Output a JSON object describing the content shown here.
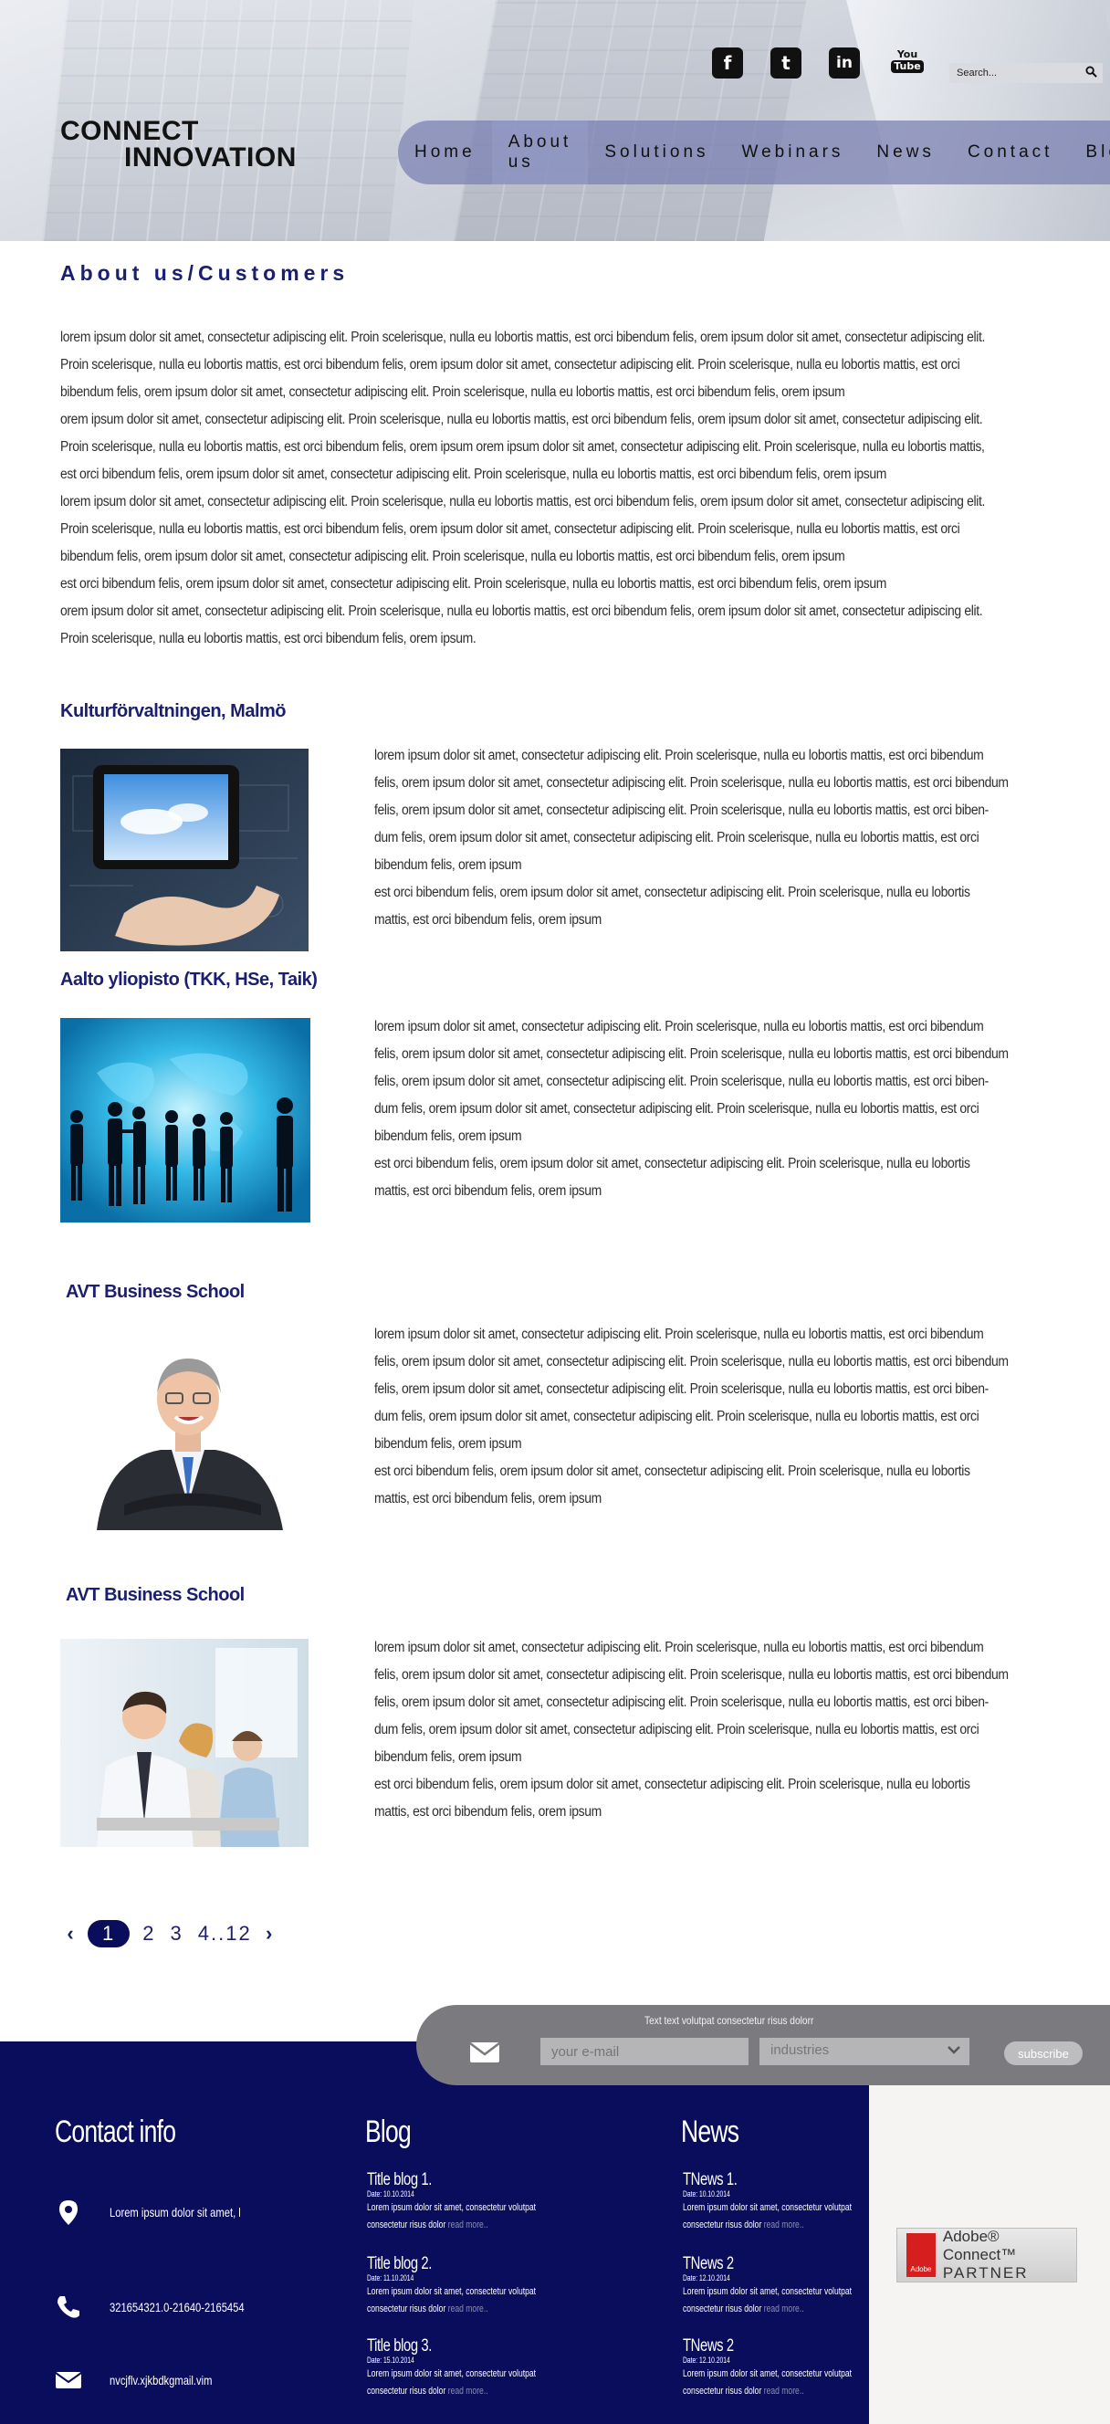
{
  "header": {
    "logo_line1": "CONNECT",
    "logo_line2": "INNOVATION",
    "social": {
      "facebook": "f",
      "twitter": "t",
      "linkedin": "in",
      "youtube_top": "You",
      "youtube_bottom": "Tube"
    },
    "search_placeholder": "Search...",
    "nav": [
      "Home",
      "About us",
      "Solutions",
      "Webinars",
      "News",
      "Contact",
      "Blog"
    ]
  },
  "main": {
    "page_title": "About us/Customers",
    "intro_lines": [
      "lorem ipsum dolor sit amet, consectetur adipiscing elit. Proin scelerisque, nulla eu lobortis mattis, est orci bibendum felis, orem ipsum dolor sit amet, consectetur adipiscing elit.",
      "Proin scelerisque, nulla eu lobortis mattis, est orci bibendum felis,  orem ipsum dolor sit amet, consectetur adipiscing elit. Proin scelerisque, nulla eu lobortis mattis, est orci",
      "bibendum felis, orem ipsum dolor sit amet, consectetur adipiscing elit. Proin scelerisque, nulla eu lobortis mattis, est orci bibendum felis, orem ipsum",
      "orem ipsum dolor sit amet, consectetur adipiscing elit. Proin scelerisque, nulla eu lobortis mattis, est orci bibendum felis, orem ipsum dolor sit amet, consectetur adipiscing elit.",
      "Proin scelerisque, nulla eu lobortis mattis, est orci bibendum felis, orem ipsum orem ipsum dolor sit amet, consectetur adipiscing elit. Proin scelerisque, nulla eu lobortis mattis,",
      "est orci bibendum felis, orem ipsum dolor sit amet, consectetur adipiscing elit. Proin scelerisque, nulla eu lobortis mattis, est orci bibendum felis, orem ipsum",
      "lorem ipsum dolor sit amet, consectetur adipiscing elit. Proin scelerisque, nulla eu lobortis mattis, est orci bibendum felis, orem ipsum dolor sit amet, consectetur adipiscing elit.",
      "Proin scelerisque, nulla eu lobortis mattis, est orci bibendum felis,  orem ipsum dolor sit amet, consectetur adipiscing elit. Proin scelerisque, nulla eu lobortis mattis, est orci",
      "bibendum felis, orem ipsum dolor sit amet, consectetur adipiscing elit. Proin scelerisque, nulla eu lobortis mattis, est orci bibendum felis, orem ipsum",
      " est orci bibendum felis, orem ipsum dolor sit amet, consectetur adipiscing elit. Proin scelerisque, nulla eu lobortis mattis, est orci bibendum felis, orem ipsum",
      "orem ipsum dolor sit amet, consectetur adipiscing elit. Proin scelerisque, nulla eu lobortis mattis, est orci bibendum felis, orem ipsum dolor sit amet, consectetur adipiscing elit.",
      "Proin scelerisque, nulla eu lobortis mattis, est orci bibendum felis, orem ipsum."
    ],
    "customers": [
      {
        "title": "Kulturförvaltningen, Malmö",
        "lines": [
          "lorem ipsum dolor sit amet, consectetur adipiscing elit. Proin scelerisque, nulla eu lobortis mattis, est orci bibendum",
          "felis, orem ipsum dolor sit amet, consectetur adipiscing elit. Proin scelerisque, nulla eu lobortis mattis, est orci bibendum",
          "felis,  orem ipsum dolor sit amet, consectetur adipiscing elit. Proin scelerisque, nulla eu lobortis mattis, est orci biben-",
          "dum felis, orem ipsum dolor sit amet, consectetur adipiscing elit. Proin scelerisque, nulla eu lobortis mattis, est orci",
          "bibendum felis, orem ipsum",
          " est orci bibendum felis, orem ipsum dolor sit amet, consectetur adipiscing elit. Proin scelerisque, nulla eu lobortis",
          "mattis, est orci bibendum felis, orem ipsum"
        ]
      },
      {
        "title": "Aalto yliopisto (TKK, HSe, Taik)",
        "lines": [
          "lorem ipsum dolor sit amet, consectetur adipiscing elit. Proin scelerisque, nulla eu lobortis mattis, est orci bibendum",
          "felis, orem ipsum dolor sit amet, consectetur adipiscing elit. Proin scelerisque, nulla eu lobortis mattis, est orci bibendum",
          "felis,  orem ipsum dolor sit amet, consectetur adipiscing elit. Proin scelerisque, nulla eu lobortis mattis, est orci biben-",
          "dum felis, orem ipsum dolor sit amet, consectetur adipiscing elit. Proin scelerisque, nulla eu lobortis mattis, est orci",
          "bibendum felis, orem ipsum",
          " est orci bibendum felis, orem ipsum dolor sit amet, consectetur adipiscing elit. Proin scelerisque, nulla eu lobortis",
          "mattis, est orci bibendum felis, orem ipsum"
        ]
      },
      {
        "title": "AVT Business School",
        "lines": [
          "lorem ipsum dolor sit amet, consectetur adipiscing elit. Proin scelerisque, nulla eu lobortis mattis, est orci bibendum",
          "felis, orem ipsum dolor sit amet, consectetur adipiscing elit. Proin scelerisque, nulla eu lobortis mattis, est orci bibendum",
          "felis,  orem ipsum dolor sit amet, consectetur adipiscing elit. Proin scelerisque, nulla eu lobortis mattis, est orci biben-",
          "dum felis, orem ipsum dolor sit amet, consectetur adipiscing elit. Proin scelerisque, nulla eu lobortis mattis, est orci",
          "bibendum felis, orem ipsum",
          " est orci bibendum felis, orem ipsum dolor sit amet, consectetur adipiscing elit. Proin scelerisque, nulla eu lobortis",
          "mattis, est orci bibendum felis, orem ipsum"
        ]
      },
      {
        "title": "AVT Business School",
        "lines": [
          "lorem ipsum dolor sit amet, consectetur adipiscing elit. Proin scelerisque, nulla eu lobortis mattis, est orci bibendum",
          "felis, orem ipsum dolor sit amet, consectetur adipiscing elit. Proin scelerisque, nulla eu lobortis mattis, est orci bibendum",
          "felis,  orem ipsum dolor sit amet, consectetur adipiscing elit. Proin scelerisque, nulla eu lobortis mattis, est orci biben-",
          "dum felis, orem ipsum dolor sit amet, consectetur adipiscing elit. Proin scelerisque, nulla eu lobortis mattis, est orci",
          "bibendum felis, orem ipsum",
          " est orci bibendum felis, orem ipsum dolor sit amet, consectetur adipiscing elit. Proin scelerisque, nulla eu lobortis",
          "mattis, est orci bibendum felis, orem ipsum"
        ]
      }
    ],
    "pagination": {
      "prev": "‹",
      "current": "1",
      "pages": [
        "2",
        "3",
        "4..12"
      ],
      "next": "›"
    }
  },
  "subscribe": {
    "caption": "Text text volutpat consectetur risus dolorr",
    "email_placeholder": "your e-mail",
    "industries": "industries",
    "button": "subscribe"
  },
  "footer": {
    "contact_title": "Contact info",
    "contact_address": "Lorem ipsum dolor sit amet, l",
    "contact_phone": "321654321.0-21640-2165454",
    "contact_email": "nvcjflv.xjkbdkgmail.vim",
    "blog_title": "Blog",
    "news_title": "News",
    "blog": [
      {
        "title": "Title blog 1.",
        "date": "Date: 10.10.2014",
        "body1": "Lorem ipsum dolor sit amet, consectetur volutpat",
        "body2": "consectetur risus dolor",
        "more": "read more.."
      },
      {
        "title": "Title blog 2.",
        "date": "Date: 11.10.2014",
        "body1": "Lorem ipsum dolor sit amet, consectetur volutpat",
        "body2": "consectetur risus dolor",
        "more": "read more.."
      },
      {
        "title": "Title blog 3.",
        "date": "Date: 15.10.2014",
        "body1": "Lorem ipsum dolor sit amet, consectetur volutpat",
        "body2": "consectetur risus dolor",
        "more": "read more.."
      }
    ],
    "news": [
      {
        "title": "TNews 1.",
        "date": "Date: 10.10.2014",
        "body1": "Lorem ipsum dolor sit amet, consectetur volutpat",
        "body2": "consectetur risus dolor",
        "more": "read more.."
      },
      {
        "title": "TNews 2",
        "date": "Date: 12.10.2014",
        "body1": "Lorem ipsum dolor sit amet, consectetur volutpat",
        "body2": "consectetur risus dolor",
        "more": "read more.."
      },
      {
        "title": "TNews 2",
        "date": "Date: 12.10.2014",
        "body1": "Lorem ipsum dolor sit amet, consectetur volutpat",
        "body2": "consectetur risus dolor",
        "more": "read more.."
      }
    ],
    "partner_line1": "Adobe® Connect™",
    "partner_line2": "PARTNER",
    "partner_logo_text": "Adobe"
  },
  "colors": {
    "navy": "#0a0d5c",
    "title_blue": "#1b1f6e",
    "nav_band": "#787eb2",
    "subscribe_bar": "#7b7b7f"
  }
}
